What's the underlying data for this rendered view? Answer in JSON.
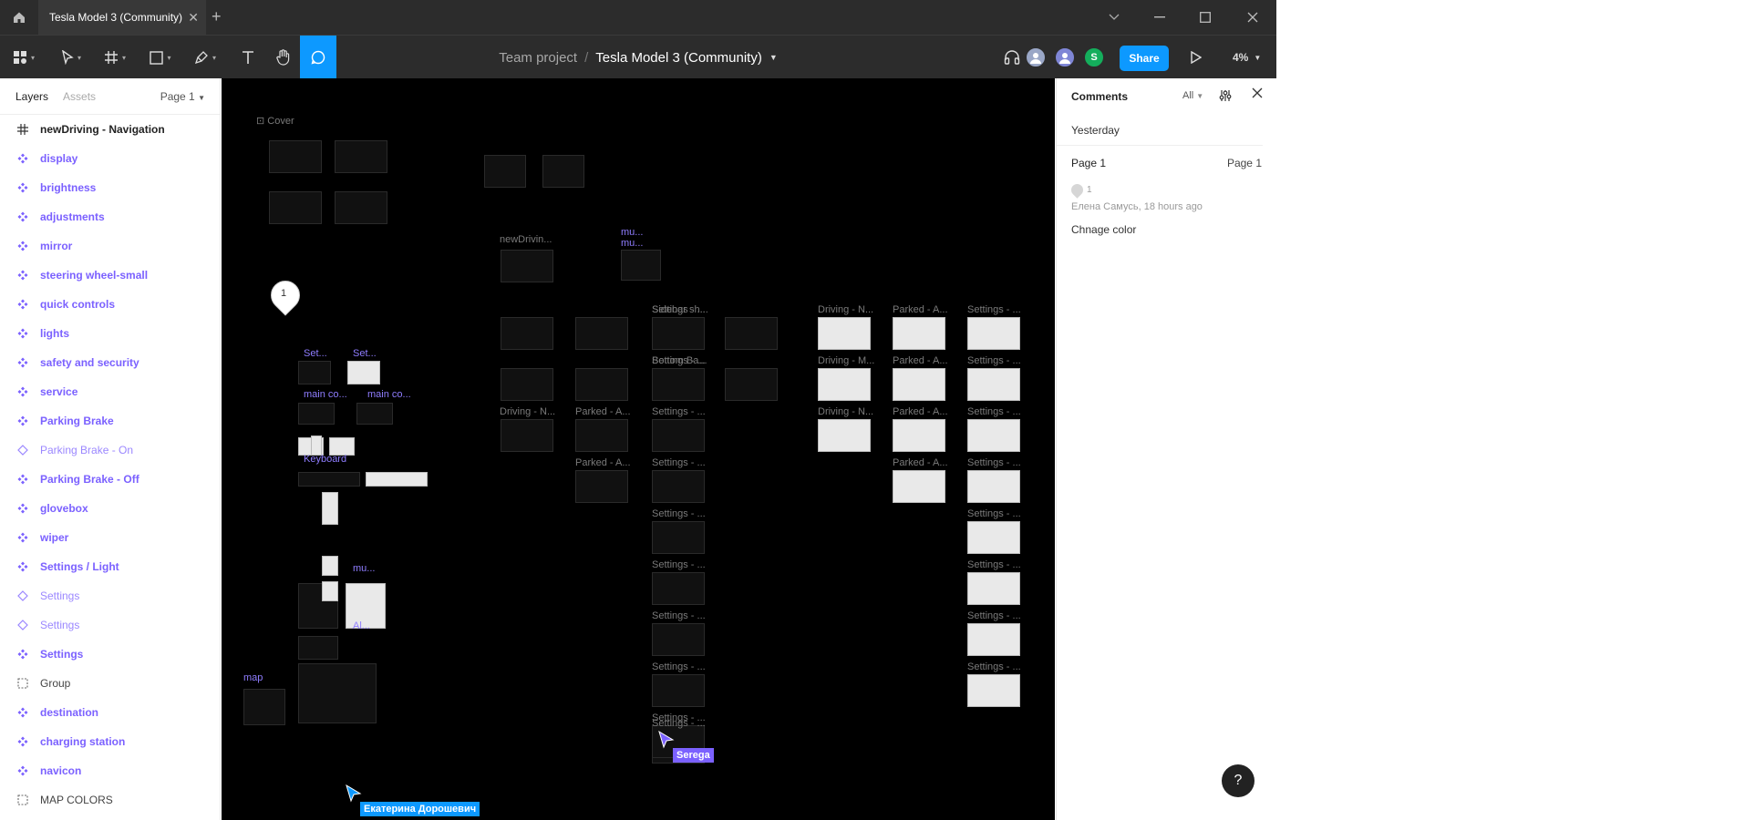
{
  "titlebar": {
    "tab_title": "Tesla Model 3 (Community)",
    "tab_close": "✕",
    "new_tab": "+"
  },
  "toolbar": {
    "team": "Team project",
    "separator": "/",
    "file": "Tesla Model 3 (Community)",
    "avatar_s": "S",
    "share_label": "Share",
    "zoom": "4%"
  },
  "left_panel": {
    "tabs": [
      "Layers",
      "Assets"
    ],
    "page": "Page 1",
    "layers": [
      {
        "label": "newDriving - Navigation",
        "type": "frame"
      },
      {
        "label": "display",
        "type": "comp"
      },
      {
        "label": "brightness",
        "type": "comp"
      },
      {
        "label": "adjustments",
        "type": "comp"
      },
      {
        "label": "mirror",
        "type": "comp"
      },
      {
        "label": "steering wheel-small",
        "type": "comp"
      },
      {
        "label": "quick controls",
        "type": "comp"
      },
      {
        "label": "lights",
        "type": "comp"
      },
      {
        "label": "safety and security",
        "type": "comp"
      },
      {
        "label": "service",
        "type": "comp"
      },
      {
        "label": "Parking Brake",
        "type": "comp"
      },
      {
        "label": "Parking Brake - On",
        "type": "inst"
      },
      {
        "label": "Parking Brake - Off",
        "type": "comp"
      },
      {
        "label": "glovebox",
        "type": "comp"
      },
      {
        "label": "wiper",
        "type": "comp"
      },
      {
        "label": "Settings / Light",
        "type": "comp"
      },
      {
        "label": "Settings",
        "type": "inst"
      },
      {
        "label": "Settings",
        "type": "inst"
      },
      {
        "label": "Settings",
        "type": "comp"
      },
      {
        "label": "Group",
        "type": "group"
      },
      {
        "label": "destination",
        "type": "comp"
      },
      {
        "label": "charging station",
        "type": "comp"
      },
      {
        "label": "navicon",
        "type": "comp"
      },
      {
        "label": "MAP COLORS",
        "type": "group"
      }
    ]
  },
  "canvas": {
    "cover_label": "Cover",
    "pin_number": "1",
    "frame_labels": {
      "new_driving": "newDrivin...",
      "settings": "Settings - ...",
      "sidebar": "Sidebar sh...",
      "bottom_bar": "Bottom Ba...",
      "driving_n": "Driving - N...",
      "driving_m": "Driving - M...",
      "parked_a": "Parked - A..."
    },
    "comp_labels": {
      "mu": "mu...",
      "set": "Set...",
      "main_co": "main co...",
      "ai": "Al...",
      "map": "map",
      "keyboard": "Keyboard"
    },
    "cursors": [
      {
        "name": "Serega",
        "color": "#7b61ff"
      },
      {
        "name": "Екатерина Дорошевич",
        "color": "#0d99ff"
      }
    ]
  },
  "right_panel": {
    "title": "Comments",
    "filter": "All",
    "day": "Yesterday",
    "page_label": "Page 1",
    "page_right": "Page 1",
    "comment": {
      "number": "1",
      "author": "Елена Самусь, 18 hours ago",
      "body": "Chnage color"
    },
    "help": "?"
  }
}
